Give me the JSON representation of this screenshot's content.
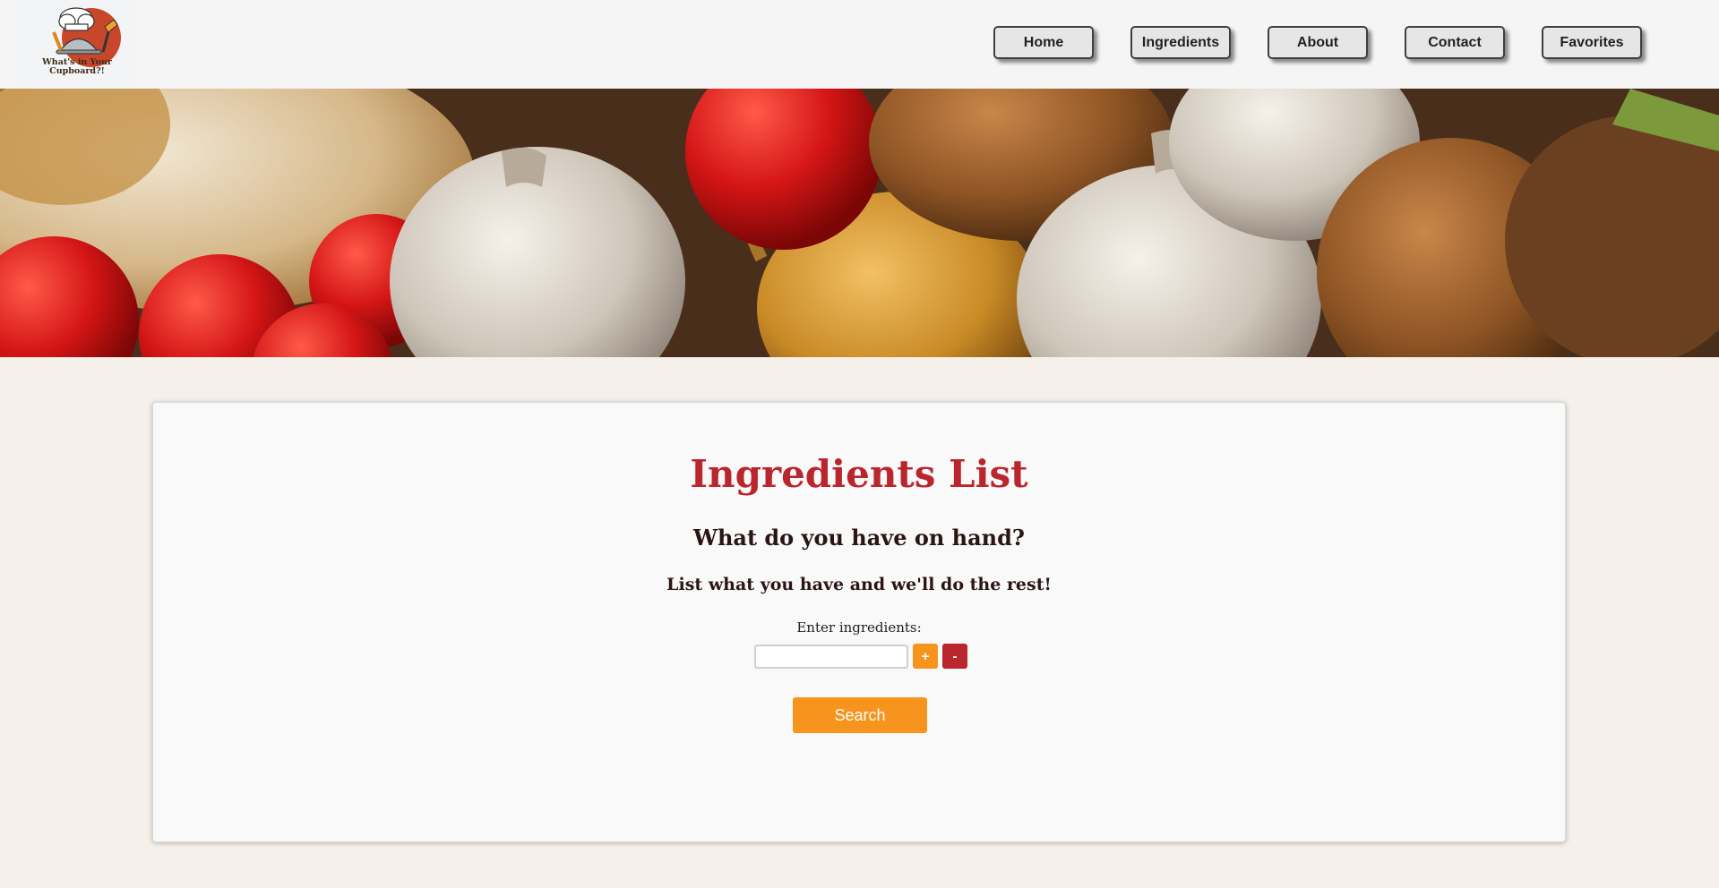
{
  "brand": {
    "logo_text_line1": "What's in Your",
    "logo_text_line2": "Cupboard?!"
  },
  "nav": {
    "items": [
      {
        "label": "Home"
      },
      {
        "label": "Ingredients"
      },
      {
        "label": "About"
      },
      {
        "label": "Contact"
      },
      {
        "label": "Favorites"
      }
    ]
  },
  "hero": {
    "image": "vegetables-banner"
  },
  "main": {
    "title": "Ingredients List",
    "subtitle": "What do you have on hand?",
    "tagline": "List what you have and we'll do the rest!",
    "input_label": "Enter ingredients:",
    "input_value": "",
    "add_label": "+",
    "remove_label": "-",
    "search_label": "Search"
  },
  "colors": {
    "accent_red": "#b9262e",
    "accent_orange": "#f7941e",
    "page_bg": "#f5f0ea"
  }
}
